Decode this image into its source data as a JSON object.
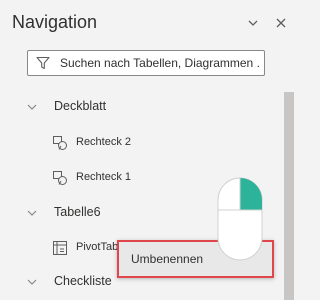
{
  "pane": {
    "title": "Navigation",
    "search_placeholder": "Suchen nach Tabellen, Diagrammen ...",
    "icons": {
      "collapse": "chevron-down-icon",
      "close": "close-icon",
      "filter": "filter-icon"
    }
  },
  "tree": [
    {
      "type": "group",
      "label": "Deckblatt",
      "expanded": true
    },
    {
      "type": "item",
      "label": "Rechteck 2",
      "icon": "shape-icon"
    },
    {
      "type": "item",
      "label": "Rechteck 1",
      "icon": "shape-icon"
    },
    {
      "type": "group",
      "label": "Tabelle6",
      "expanded": true
    },
    {
      "type": "item",
      "label": "PivotTable3",
      "icon": "pivot-table-icon"
    },
    {
      "type": "group",
      "label": "Checkliste",
      "expanded": true
    }
  ],
  "context_menu": {
    "items": [
      {
        "label": "Umbenennen"
      }
    ],
    "highlight_color": "#e0474c"
  },
  "colors": {
    "mouse_accent": "#2db39a"
  }
}
